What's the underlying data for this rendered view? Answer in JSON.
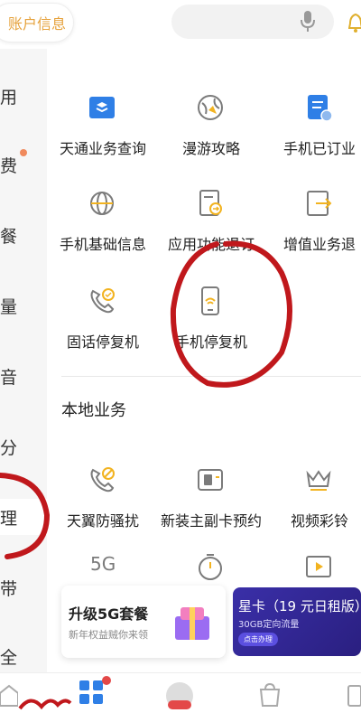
{
  "header": {
    "account_label": "账户信息"
  },
  "sidebar": {
    "items": [
      {
        "label": "用"
      },
      {
        "label": "费"
      },
      {
        "label": "餐"
      },
      {
        "label": "量"
      },
      {
        "label": "音"
      },
      {
        "label": "分"
      },
      {
        "label": "理"
      },
      {
        "label": "带"
      },
      {
        "label": "全"
      }
    ]
  },
  "grid": {
    "rows": [
      [
        {
          "label": "天通业务查询",
          "icon": "satellite-card-icon"
        },
        {
          "label": "漫游攻略",
          "icon": "roaming-globe-icon"
        },
        {
          "label": "手机已订业",
          "icon": "subscribed-document-icon"
        }
      ],
      [
        {
          "label": "手机基础信息",
          "icon": "phone-info-icon"
        },
        {
          "label": "应用功能退订",
          "icon": "unsubscribe-icon"
        },
        {
          "label": "增值业务退",
          "icon": "value-added-exit-icon"
        }
      ],
      [
        {
          "label": "固话停复机",
          "icon": "landline-phone-icon"
        },
        {
          "label": "手机停复机",
          "icon": "mobile-suspend-icon"
        }
      ]
    ]
  },
  "local_section": {
    "title": "本地业务",
    "rows": [
      [
        {
          "label": "天翼防骚扰",
          "icon": "anti-harassment-icon"
        },
        {
          "label": "新装主副卡预约",
          "icon": "sim-card-icon"
        },
        {
          "label": "视频彩铃",
          "icon": "crown-icon"
        }
      ]
    ],
    "partial_row": [
      {
        "label": "5G",
        "icon": "5g-icon"
      },
      {
        "label": "",
        "icon": "timer-icon"
      },
      {
        "label": "",
        "icon": "video-icon"
      }
    ]
  },
  "promo": {
    "left_title": "升级5G套餐",
    "left_sub": "新年权益贼你来领",
    "right_title": "星卡（19 元日租版）",
    "right_sub": "30GB定向流量",
    "right_button": "点击办理"
  },
  "colors": {
    "accent_blue": "#2f7fe6",
    "icon_gray": "#7b7b7b",
    "annotation_red": "#c0181c"
  }
}
